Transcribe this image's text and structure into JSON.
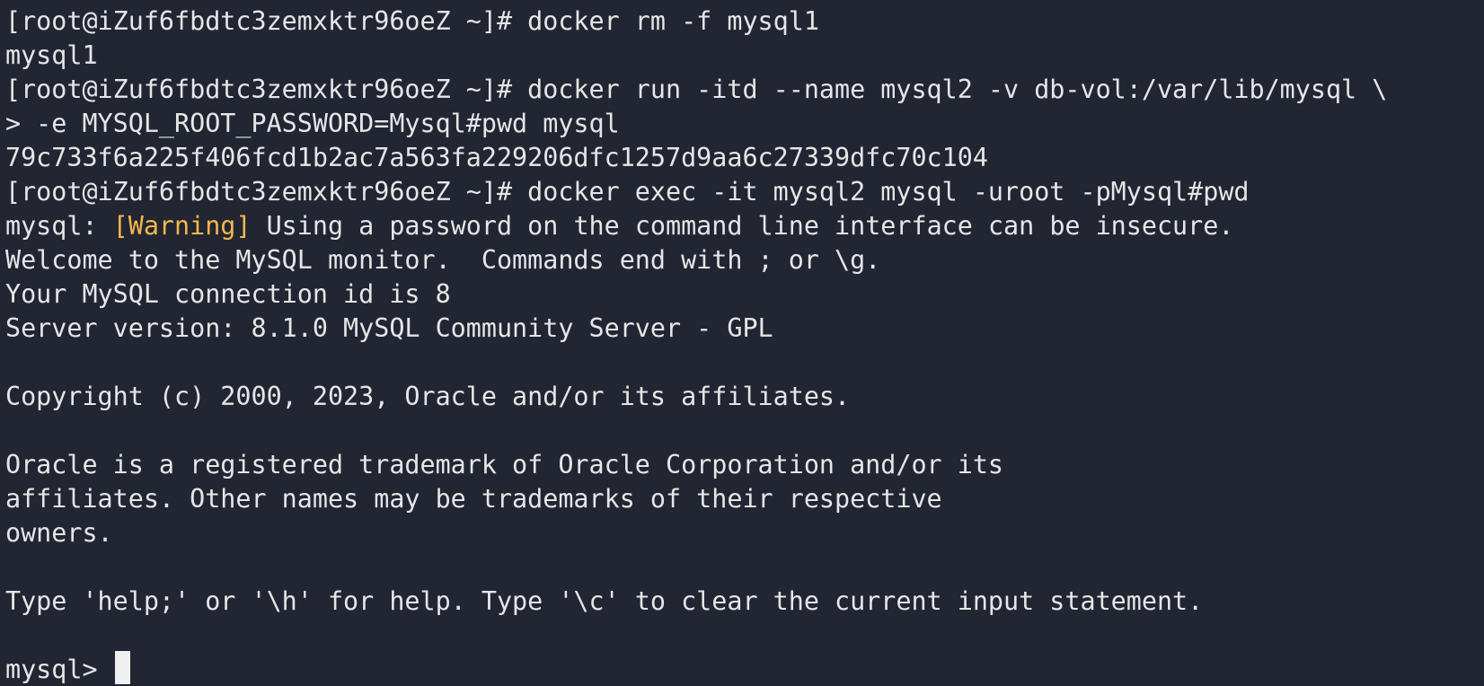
{
  "terminal": {
    "partial_top": "~",
    "line_01": "[root@iZuf6fbdtc3zemxktr96oeZ ~]# docker rm -f mysql1",
    "line_02": "mysql1",
    "line_03": "[root@iZuf6fbdtc3zemxktr96oeZ ~]# docker run -itd --name mysql2 -v db-vol:/var/lib/mysql \\",
    "line_04": "> -e MYSQL_ROOT_PASSWORD=Mysql#pwd mysql",
    "line_05": "79c733f6a225f406fcd1b2ac7a563fa229206dfc1257d9aa6c27339dfc70c104",
    "line_06": "[root@iZuf6fbdtc3zemxktr96oeZ ~]# docker exec -it mysql2 mysql -uroot -pMysql#pwd",
    "line_07_prefix": "mysql: ",
    "line_07_warning": "[Warning]",
    "line_07_suffix": " Using a password on the command line interface can be insecure.",
    "line_08": "Welcome to the MySQL monitor.  Commands end with ; or \\g.",
    "line_09": "Your MySQL connection id is 8",
    "line_10": "Server version: 8.1.0 MySQL Community Server - GPL",
    "line_12": "Copyright (c) 2000, 2023, Oracle and/or its affiliates.",
    "line_14": "Oracle is a registered trademark of Oracle Corporation and/or its",
    "line_15": "affiliates. Other names may be trademarks of their respective",
    "line_16": "owners.",
    "line_18": "Type 'help;' or '\\h' for help. Type '\\c' to clear the current input statement.",
    "prompt": "mysql> "
  },
  "colors": {
    "background": "#222633",
    "text": "#e6e6e6",
    "warning": "#f2b84b",
    "cursor": "#f0f0f0"
  }
}
